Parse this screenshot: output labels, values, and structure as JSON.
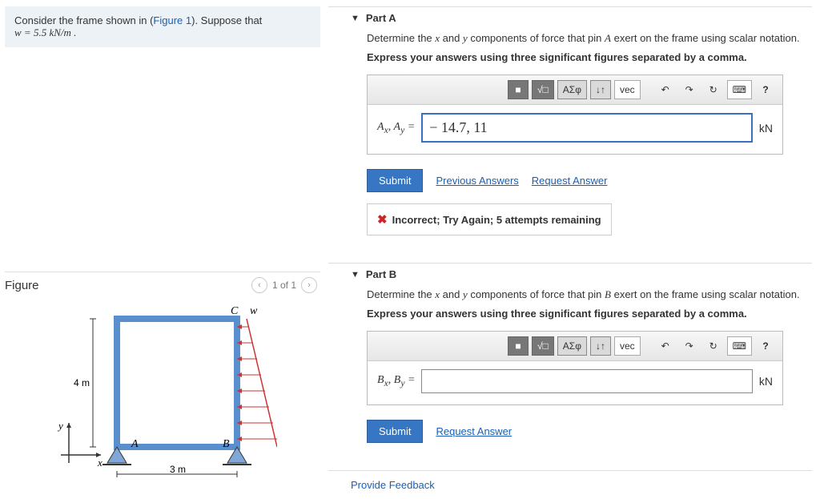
{
  "left": {
    "prompt_pre": "Consider the frame shown in (",
    "figure_link": "Figure 1",
    "prompt_post": "). Suppose that",
    "w_eq": "w = 5.5 kN/m .",
    "figure_title": "Figure",
    "pager_text": "1 of 1",
    "fig_label_C": "C",
    "fig_label_w": "w",
    "fig_label_4m": "4 m",
    "fig_label_A": "A",
    "fig_label_B": "B",
    "fig_label_3m": "3 m",
    "fig_label_x": "x",
    "fig_label_y": "y"
  },
  "toolbar": {
    "templates": "■",
    "sqrt": "√□",
    "greek": "ΑΣφ",
    "arrows": "↓↑",
    "vec": "vec",
    "undo": "↶",
    "redo": "↷",
    "reset": "↻",
    "keyboard": "⌨",
    "help": "?"
  },
  "partA": {
    "title": "Part A",
    "question_pre": "Determine the ",
    "q_x": "x",
    "q_and": " and ",
    "q_y": "y",
    "question_mid": " components of force that pin ",
    "q_pin": "A",
    "question_post": " exert on the frame using scalar notation.",
    "instruction": "Express your answers using three significant figures separated by a comma.",
    "label": "Aₓ, A_y =",
    "value": "− 14.7, 11",
    "unit": "kN",
    "submit": "Submit",
    "prev_answers": "Previous Answers",
    "request": "Request Answer",
    "feedback": "Incorrect; Try Again; 5 attempts remaining"
  },
  "partB": {
    "title": "Part B",
    "question_pre": "Determine the ",
    "q_x": "x",
    "q_and": " and ",
    "q_y": "y",
    "question_mid": " components of force that pin ",
    "q_pin": "B",
    "question_post": " exert on the frame using scalar notation.",
    "instruction": "Express your answers using three significant figures separated by a comma.",
    "label": "Bₓ, B_y =",
    "value": "",
    "unit": "kN",
    "submit": "Submit",
    "request": "Request Answer"
  },
  "footer": {
    "provide_feedback": "Provide Feedback"
  }
}
